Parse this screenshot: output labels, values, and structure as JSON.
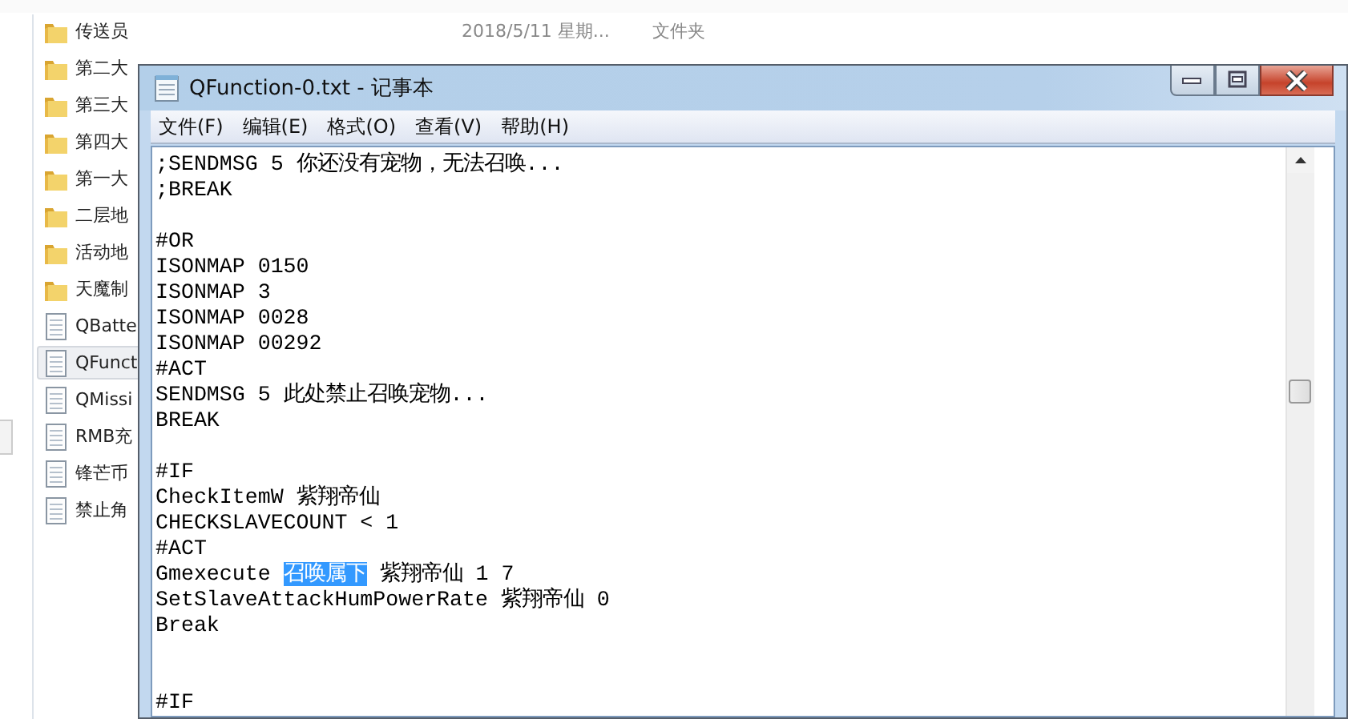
{
  "explorer": {
    "rows": [
      {
        "name": "传送员",
        "kind": "folder",
        "selected": false,
        "date": "2018/5/11 星期...",
        "type": "文件夹"
      },
      {
        "name": "第二大",
        "kind": "folder",
        "selected": false
      },
      {
        "name": "第三大",
        "kind": "folder",
        "selected": false
      },
      {
        "name": "第四大",
        "kind": "folder",
        "selected": false
      },
      {
        "name": "第一大",
        "kind": "folder",
        "selected": false
      },
      {
        "name": "二层地",
        "kind": "folder",
        "selected": false
      },
      {
        "name": "活动地",
        "kind": "folder",
        "selected": false
      },
      {
        "name": "天魔制",
        "kind": "folder",
        "selected": false
      },
      {
        "name": "QBatte",
        "kind": "file",
        "selected": false
      },
      {
        "name": "QFunct",
        "kind": "file",
        "selected": true
      },
      {
        "name": "QMissi",
        "kind": "file",
        "selected": false
      },
      {
        "name": "RMB充",
        "kind": "file",
        "selected": false
      },
      {
        "name": "锋芒币",
        "kind": "file",
        "selected": false
      },
      {
        "name": "禁止角",
        "kind": "file",
        "selected": false
      }
    ]
  },
  "notepad": {
    "title": "QFunction-0.txt - 记事本",
    "menu": [
      "文件(F)",
      "编辑(E)",
      "格式(O)",
      "查看(V)",
      "帮助(H)"
    ],
    "lines": [
      {
        "kind": "text",
        "parts": [
          {
            "text": ";SENDMSG 5 你还没有宠物，无法召唤...",
            "selected": false
          }
        ]
      },
      {
        "kind": "text",
        "parts": [
          {
            "text": ";BREAK",
            "selected": false
          }
        ]
      },
      {
        "kind": "blank"
      },
      {
        "kind": "text",
        "parts": [
          {
            "text": "#OR",
            "selected": false
          }
        ]
      },
      {
        "kind": "text",
        "parts": [
          {
            "text": "ISONMAP 0150",
            "selected": false
          }
        ]
      },
      {
        "kind": "text",
        "parts": [
          {
            "text": "ISONMAP 3",
            "selected": false
          }
        ]
      },
      {
        "kind": "text",
        "parts": [
          {
            "text": "ISONMAP 0028",
            "selected": false
          }
        ]
      },
      {
        "kind": "text",
        "parts": [
          {
            "text": "ISONMAP 00292",
            "selected": false
          }
        ]
      },
      {
        "kind": "text",
        "parts": [
          {
            "text": "#ACT",
            "selected": false
          }
        ]
      },
      {
        "kind": "text",
        "parts": [
          {
            "text": "SENDMSG 5 此处禁止召唤宠物...",
            "selected": false
          }
        ]
      },
      {
        "kind": "text",
        "parts": [
          {
            "text": "BREAK",
            "selected": false
          }
        ]
      },
      {
        "kind": "blank"
      },
      {
        "kind": "text",
        "parts": [
          {
            "text": "#IF",
            "selected": false
          }
        ]
      },
      {
        "kind": "text",
        "parts": [
          {
            "text": "CheckItemW 紫翔帝仙",
            "selected": false
          }
        ]
      },
      {
        "kind": "text",
        "parts": [
          {
            "text": "CHECKSLAVECOUNT < 1",
            "selected": false
          }
        ]
      },
      {
        "kind": "text",
        "parts": [
          {
            "text": "#ACT",
            "selected": false
          }
        ]
      },
      {
        "kind": "text",
        "parts": [
          {
            "text": "Gmexecute ",
            "selected": false
          },
          {
            "text": "召唤属下",
            "selected": true
          },
          {
            "text": " 紫翔帝仙 1 7",
            "selected": false
          }
        ]
      },
      {
        "kind": "text",
        "parts": [
          {
            "text": "SetSlaveAttackHumPowerRate 紫翔帝仙 0",
            "selected": false
          }
        ]
      },
      {
        "kind": "text",
        "parts": [
          {
            "text": "Break",
            "selected": false
          }
        ]
      },
      {
        "kind": "blank"
      },
      {
        "kind": "blank"
      },
      {
        "kind": "text",
        "parts": [
          {
            "text": "#IF",
            "selected": false
          }
        ]
      }
    ]
  }
}
